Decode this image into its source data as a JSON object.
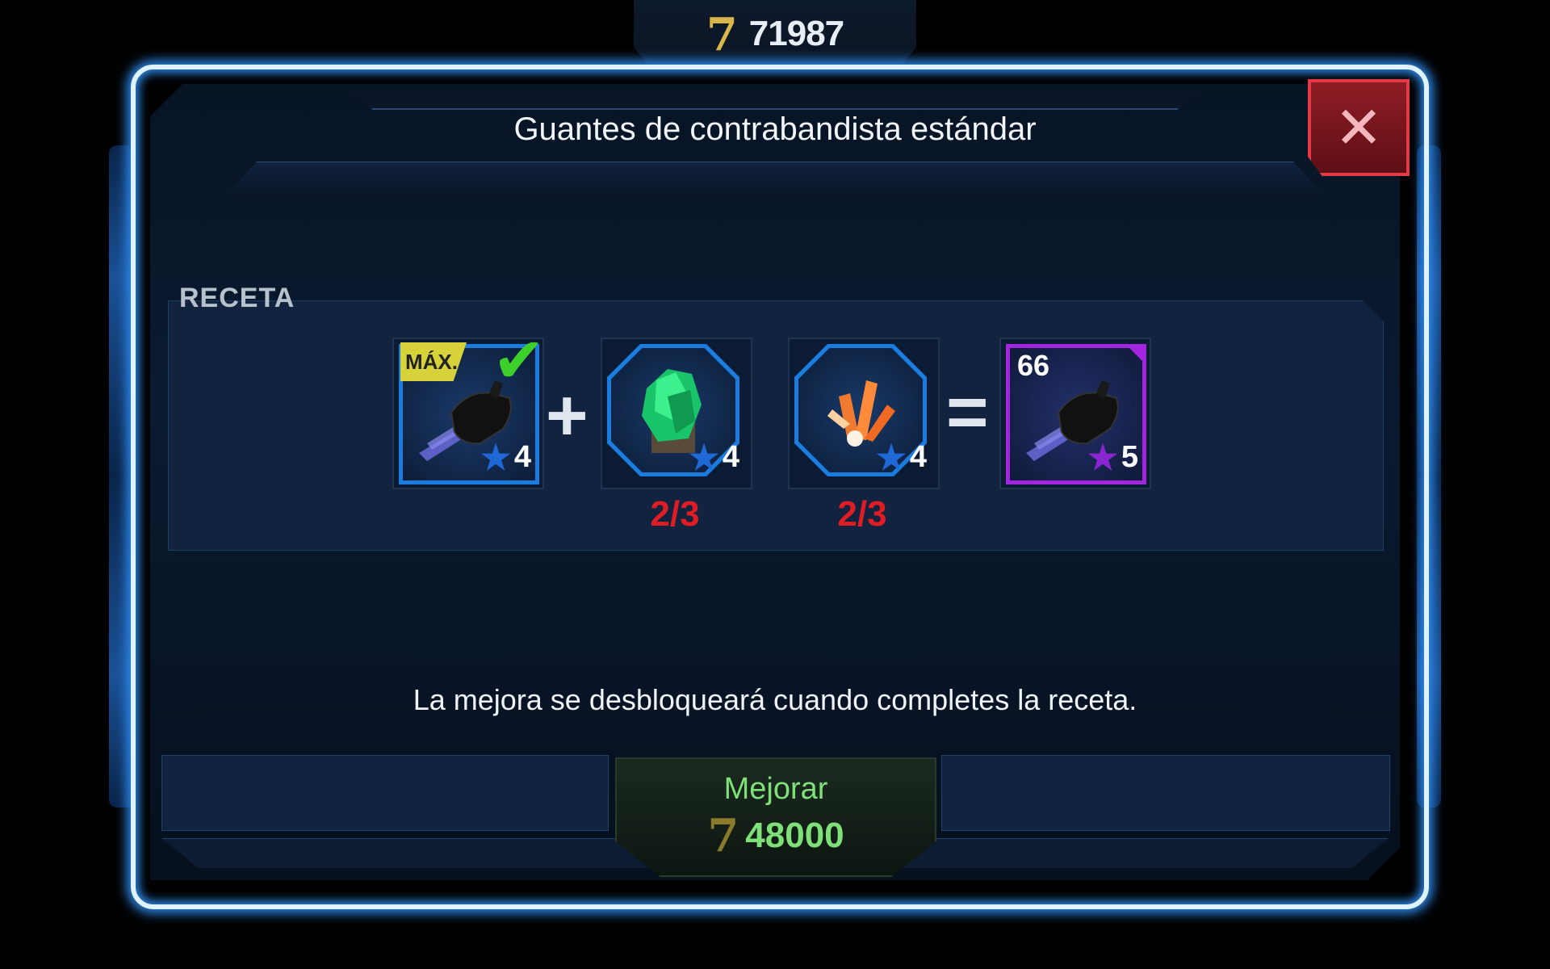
{
  "currency": {
    "icon": "credits-icon",
    "symbol": "7",
    "amount": "71987"
  },
  "dialog": {
    "title": "Guantes de contrabandista estándar",
    "close_icon": "close-icon"
  },
  "recipe": {
    "label": "RECETA",
    "inputs": [
      {
        "name": "glove-item",
        "badge": "MÁX.",
        "completed": true,
        "stars": "4",
        "star_color": "#1f68d6"
      },
      {
        "name": "green-crystal-item",
        "stars": "4",
        "count": "2/3",
        "star_color": "#1f68d6"
      },
      {
        "name": "orange-crystal-item",
        "stars": "4",
        "count": "2/3",
        "star_color": "#1f68d6"
      }
    ],
    "plus": "+",
    "equals": "=",
    "result": {
      "name": "upgraded-glove-item",
      "level": "66",
      "stars": "5",
      "star_color": "#8a26d0"
    }
  },
  "message": "La mejora se desbloqueará cuando completes la receta.",
  "upgrade_button": {
    "label": "Mejorar",
    "currency_symbol": "7",
    "cost": "48000"
  },
  "colors": {
    "accent": "#2f8df0",
    "close": "#e33a46",
    "missing": "#e01d24",
    "upgrade_text": "#7fe07a"
  }
}
